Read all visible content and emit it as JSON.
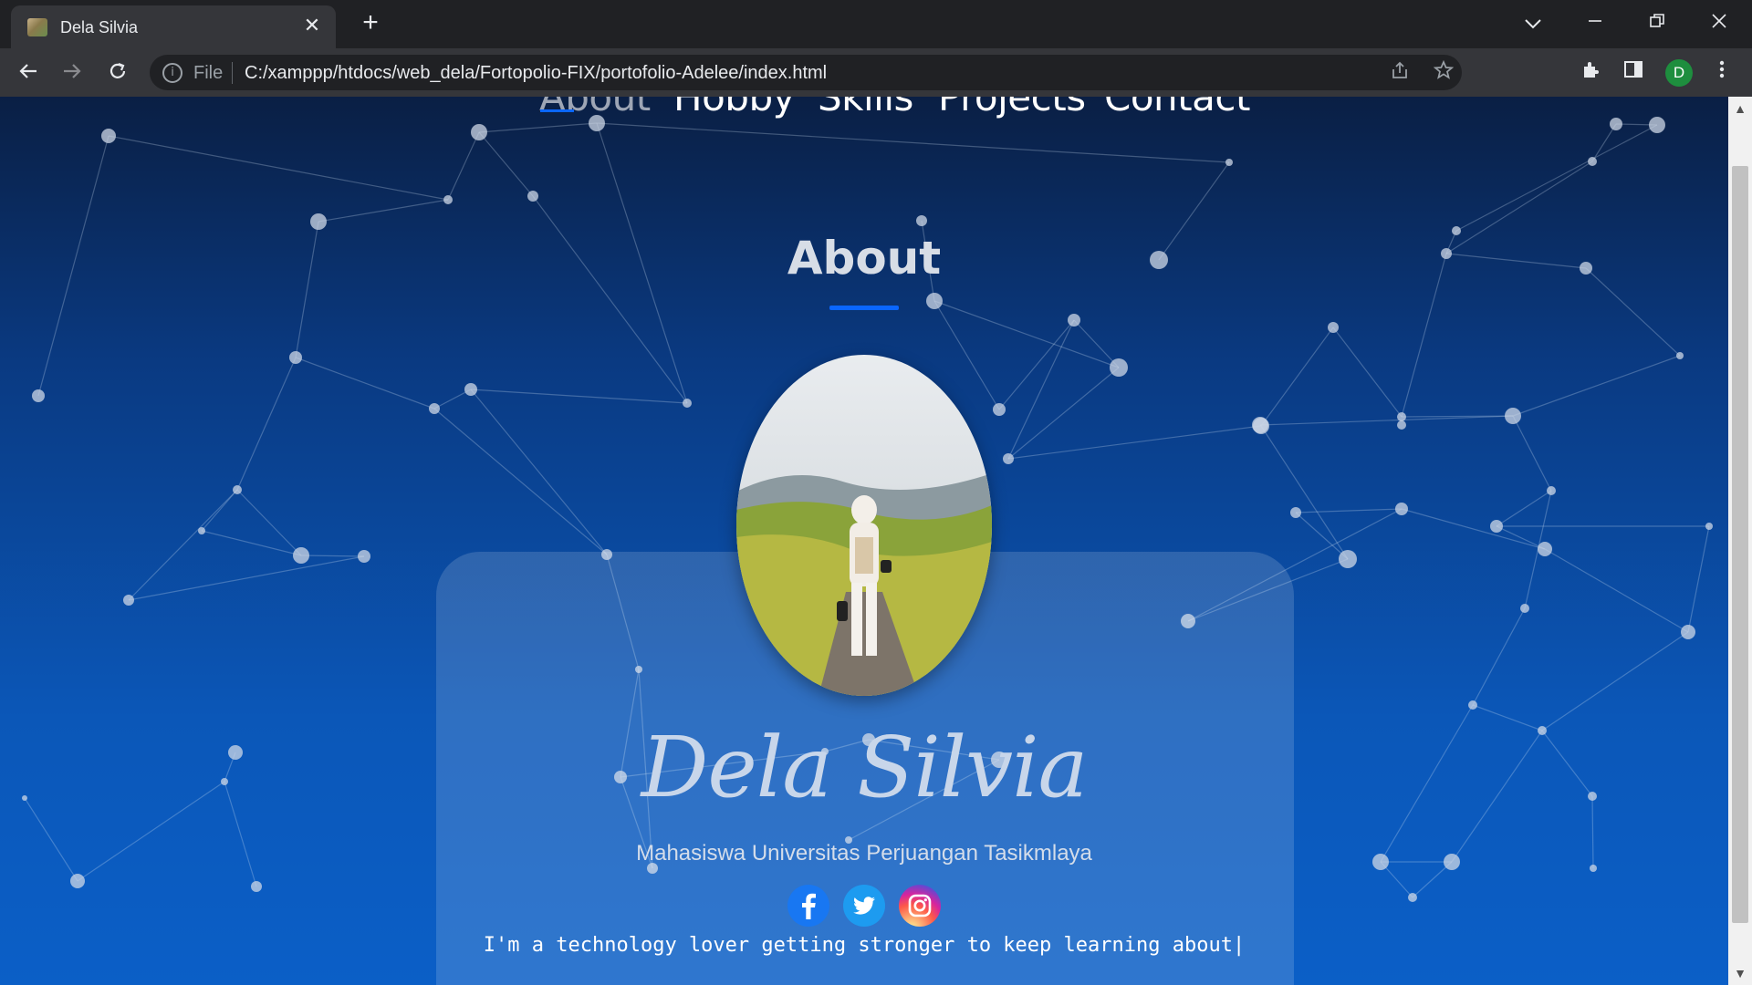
{
  "browser": {
    "tab_title": "Dela Silvia",
    "tab_close": "✕",
    "new_tab": "+",
    "omnibox_scheme": "File",
    "url": "C:/xamppp/htdocs/web_dela/Fortopolio-FIX/portofolio-Adelee/index.html",
    "profile_initial": "D"
  },
  "nav": {
    "items": [
      "About",
      "Hobby",
      "Skills",
      "Projects",
      "Contact"
    ],
    "active": "About"
  },
  "about": {
    "title": "About",
    "name": "Dela Silvia",
    "subtitle": "Mahasiswa Universitas Perjuangan Tasikmlaya",
    "typed_text": "I'm a technology lover getting stronger to keep learning about|",
    "socials": [
      "facebook-icon",
      "twitter-icon",
      "instagram-icon"
    ]
  },
  "colors": {
    "accent": "#0a66ff",
    "bg_top": "#0a1f44",
    "bg_bottom": "#0b5fc7",
    "facebook": "#1877f2",
    "twitter": "#1d9bf0"
  }
}
